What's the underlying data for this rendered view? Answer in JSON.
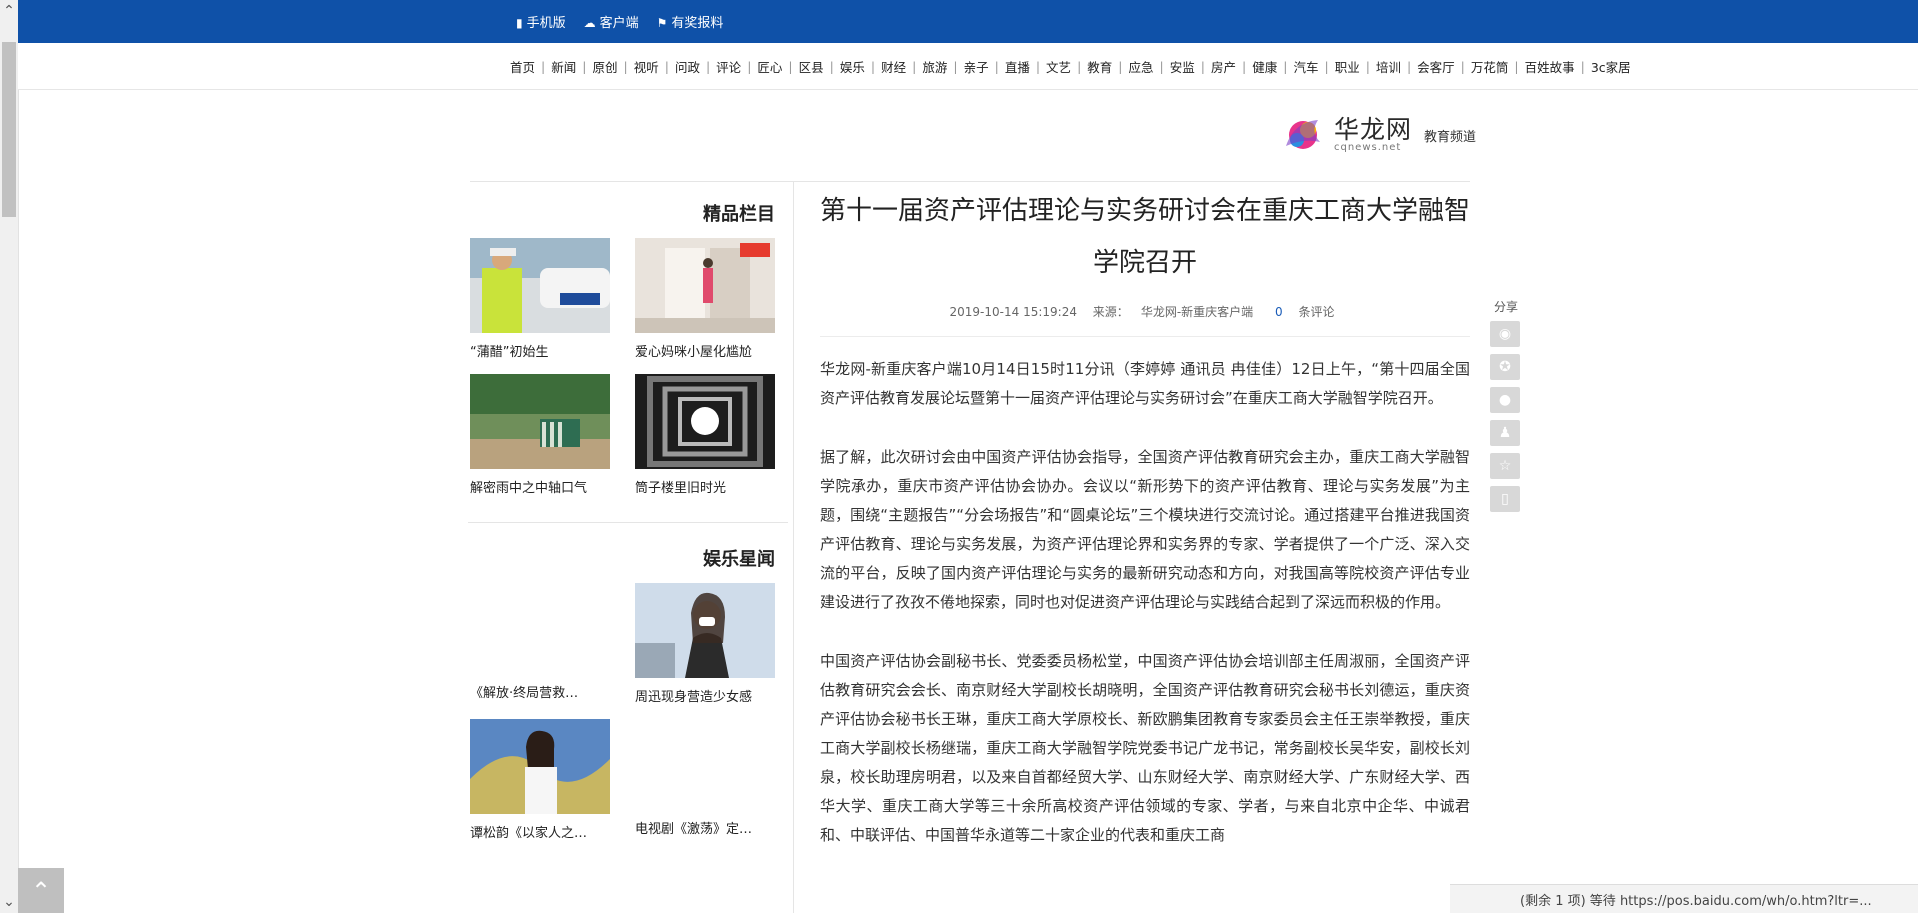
{
  "topbar": {
    "items": [
      {
        "icon": "phone-icon",
        "label": "手机版"
      },
      {
        "icon": "app-icon",
        "label": "客户端"
      },
      {
        "icon": "flag-icon",
        "label": "有奖报料"
      }
    ],
    "bg_color": "#0f51a8"
  },
  "nav": {
    "items": [
      "首页",
      "新闻",
      "原创",
      "视听",
      "问政",
      "评论",
      "匠心",
      "区县",
      "娱乐",
      "财经",
      "旅游",
      "亲子",
      "直播",
      "文艺",
      "教育",
      "应急",
      "安监",
      "房产",
      "健康",
      "汽车",
      "职业",
      "培训",
      "会客厅",
      "万花筒",
      "百姓故事",
      "3c家居"
    ]
  },
  "header": {
    "logo_name": "华龙网",
    "logo_domain": "cqnews.net",
    "channel": "教育频道"
  },
  "article": {
    "title": "第十一届资产评估理论与实务研讨会在重庆工商大学融智学院召开",
    "date": "2019-10-14 15:19:24",
    "source_label": "来源：",
    "source": "华龙网-新重庆客户端",
    "comment_count": "0",
    "comment_label": "条评论",
    "paragraphs": [
      "华龙网-新重庆客户端10月14日15时11分讯（李婷婷 通讯员 冉佳佳）12日上午，“第十四届全国资产评估教育发展论坛暨第十一届资产评估理论与实务研讨会”在重庆工商大学融智学院召开。",
      "据了解，此次研讨会由中国资产评估协会指导，全国资产评估教育研究会主办，重庆工商大学融智学院承办，重庆市资产评估协会协办。会议以“新形势下的资产评估教育、理论与实务发展”为主题，围绕“主题报告”“分会场报告”和“圆桌论坛”三个模块进行交流讨论。通过搭建平台推进我国资产评估教育、理论与实务发展，为资产评估理论界和实务界的专家、学者提供了一个广泛、深入交流的平台，反映了国内资产评估理论与实务的最新研究动态和方向，对我国高等院校资产评估专业建设进行了孜孜不倦地探索，同时也对促进资产评估理论与实践结合起到了深远而积极的作用。",
      "中国资产评估协会副秘书长、党委委员杨松堂，中国资产评估协会培训部主任周淑丽，全国资产评估教育研究会会长、南京财经大学副校长胡晓明，全国资产评估教育研究会秘书长刘德运，重庆资产评估协会秘书长王琳，重庆工商大学原校长、新欧鹏集团教育专家委员会主任王崇举教授，重庆工商大学副校长杨继瑞，重庆工商大学融智学院党委书记广龙书记，常务副校长吴华安，副校长刘泉，校长助理房明君，以及来自首都经贸大学、山东财经大学、南京财经大学、广东财经大学、西华大学、重庆工商大学等三十余所高校资产评估领域的专家、学者，与来自北京中企华、中诚君和、中联评估、中国普华永道等二十家企业的代表和重庆工商"
    ]
  },
  "share": {
    "label": "分享",
    "icons": [
      "weibo-icon",
      "qzone-icon",
      "wechat-icon",
      "qq-icon",
      "favorite-icon",
      "mobile-icon"
    ]
  },
  "sidebar": {
    "section1_title": "精品栏目",
    "section1_items": [
      {
        "caption": "“蒲醋”初始生",
        "image": "police-car-photo"
      },
      {
        "caption": "爱心妈咪小屋化尴尬",
        "image": "nursing-room-photo"
      },
      {
        "caption": "解密雨中之中轴口气",
        "image": "park-chairs-photo"
      },
      {
        "caption": "筒子楼里旧时光",
        "image": "tube-building-photo"
      }
    ],
    "section2_title": "娱乐星闻",
    "section2_items": [
      {
        "caption": "《解放·终局营救…",
        "image": ""
      },
      {
        "caption": "周迅现身营造少女感",
        "image": "woman-mask-photo"
      },
      {
        "caption": "谭松韵《以家人之…",
        "image": "girl-painting-photo"
      },
      {
        "caption": "电视剧《激荡》定…",
        "image": ""
      }
    ]
  },
  "bottombar": {
    "text": "(剩余 1 项) 等待 https://pos.baidu.com/wh/o.htm?ltr=..."
  },
  "icons": {
    "scroll_up": "chevron-up-icon",
    "scroll_down": "chevron-down-icon",
    "back_to_top": "back-to-top-icon"
  }
}
